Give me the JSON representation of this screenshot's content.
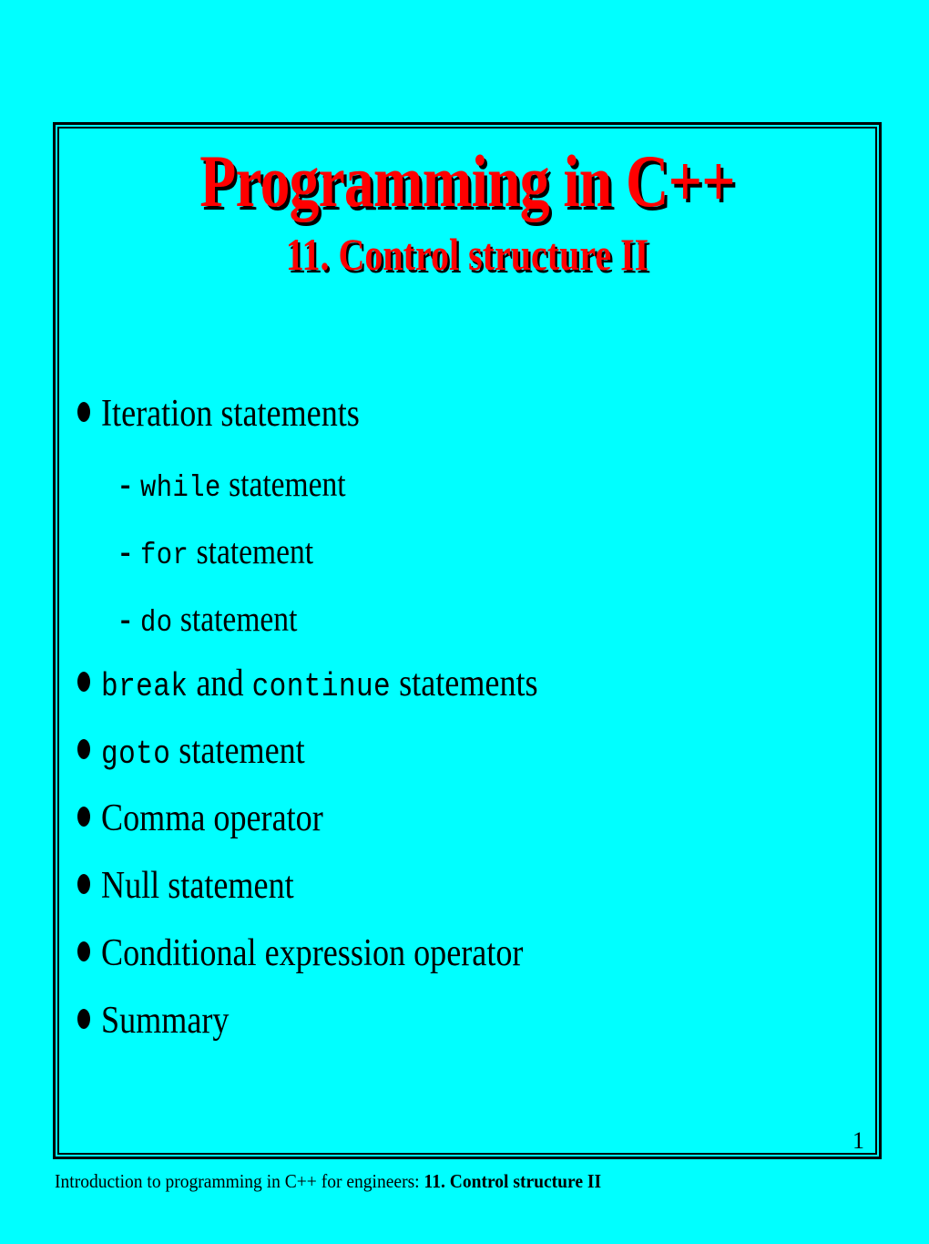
{
  "colors": {
    "background": "#00FFFF",
    "title_fill": "#FF0000",
    "title_shadow": "#000000",
    "body_text": "#000000",
    "frame": "#000000"
  },
  "title": {
    "main": "Programming in C++",
    "subtitle": "11. Control structure II"
  },
  "outline": {
    "items": [
      {
        "level": 1,
        "marker": "bullet",
        "parts": [
          {
            "text": "Iteration statements",
            "style": "normal"
          }
        ]
      },
      {
        "level": 2,
        "marker": "dash",
        "parts": [
          {
            "text": "while",
            "style": "code"
          },
          {
            "text": " statement",
            "style": "normal"
          }
        ]
      },
      {
        "level": 2,
        "marker": "dash",
        "parts": [
          {
            "text": "for",
            "style": "code"
          },
          {
            "text": " statement",
            "style": "normal"
          }
        ]
      },
      {
        "level": 2,
        "marker": "dash",
        "parts": [
          {
            "text": "do",
            "style": "code"
          },
          {
            "text": " statement",
            "style": "normal"
          }
        ]
      },
      {
        "level": 1,
        "marker": "bullet",
        "parts": [
          {
            "text": "break",
            "style": "code"
          },
          {
            "text": " and ",
            "style": "normal"
          },
          {
            "text": "continue",
            "style": "code"
          },
          {
            "text": " statements",
            "style": "normal"
          }
        ]
      },
      {
        "level": 1,
        "marker": "bullet",
        "parts": [
          {
            "text": "goto",
            "style": "code"
          },
          {
            "text": " statement",
            "style": "normal"
          }
        ]
      },
      {
        "level": 1,
        "marker": "bullet",
        "parts": [
          {
            "text": "Comma operator",
            "style": "normal"
          }
        ]
      },
      {
        "level": 1,
        "marker": "bullet",
        "parts": [
          {
            "text": "Null statement",
            "style": "normal"
          }
        ]
      },
      {
        "level": 1,
        "marker": "bullet",
        "parts": [
          {
            "text": "Conditional expression operator",
            "style": "normal"
          }
        ]
      },
      {
        "level": 1,
        "marker": "bullet",
        "parts": [
          {
            "text": "Summary",
            "style": "normal"
          }
        ]
      }
    ]
  },
  "page_number": "1",
  "footer": {
    "prefix": "Introduction to programming in C++ for engineers: ",
    "bold": "11. Control structure II"
  },
  "markers": {
    "dash_glyph": "-"
  }
}
